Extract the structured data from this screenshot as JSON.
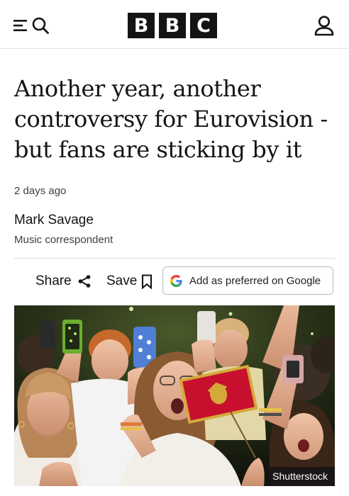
{
  "header": {
    "brand_letters": [
      "B",
      "B",
      "C"
    ],
    "menu_icon": "menu-icon",
    "search_icon": "search-icon",
    "account_icon": "account-icon"
  },
  "article": {
    "headline": "Another year, another controversy for Eurovision - but fans are sticking by it",
    "timestamp": "2 days ago",
    "author": {
      "name": "Mark Savage",
      "role": "Music correspondent"
    }
  },
  "actions": {
    "share_label": "Share",
    "save_label": "Save",
    "google_label": "Add as preferred on Google"
  },
  "image": {
    "credit": "Shutterstock"
  },
  "colors": {
    "brand_block": "#141414",
    "text": "#141414",
    "muted": "#3f3f3f"
  }
}
